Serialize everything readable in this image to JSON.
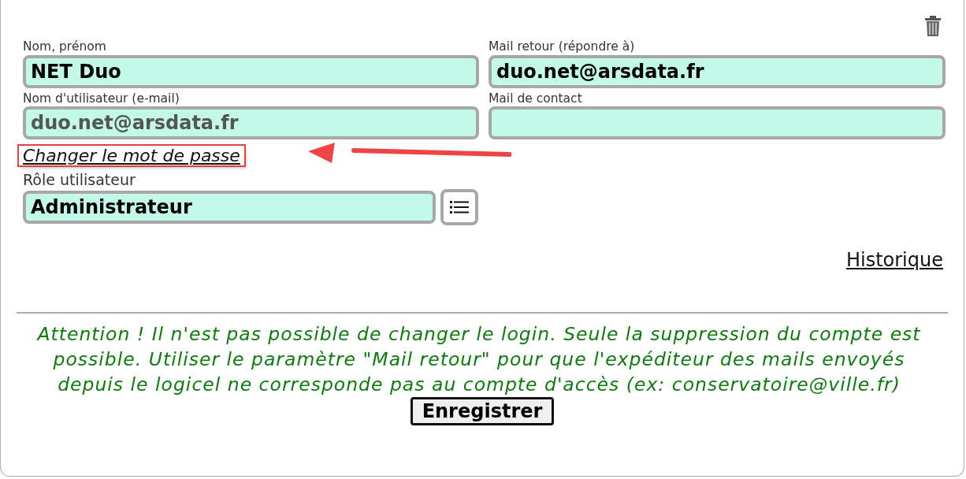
{
  "fields": [
    {
      "label": "Nom, prénom",
      "value": "NET Duo"
    },
    {
      "label": "Mail retour (répondre à)",
      "value": "duo.net@arsdata.fr"
    },
    {
      "label": "Mail de contact"
    }
  ],
  "username_field": {
    "label": "Nom d'utilisateur (e-mail)",
    "value": "duo.net@arsdata.fr",
    "disabled": true
  },
  "password_link": {
    "label": "Changer le mot de passe",
    "highlighted": true
  },
  "role": {
    "label": "Rôle utilisateur",
    "value": "Administrateur"
  },
  "history_link": "Historique",
  "warning": "Attention ! Il n'est pas possible de changer le login. Seule la suppression du compte est possible. Utiliser le paramètre \"Mail retour\" pour que l'expéditeur des mails envoyés depuis le logicel ne corresponde pas au compte d'accès (ex: conservatoire@ville.fr)",
  "save_button": "Enregistrer"
}
